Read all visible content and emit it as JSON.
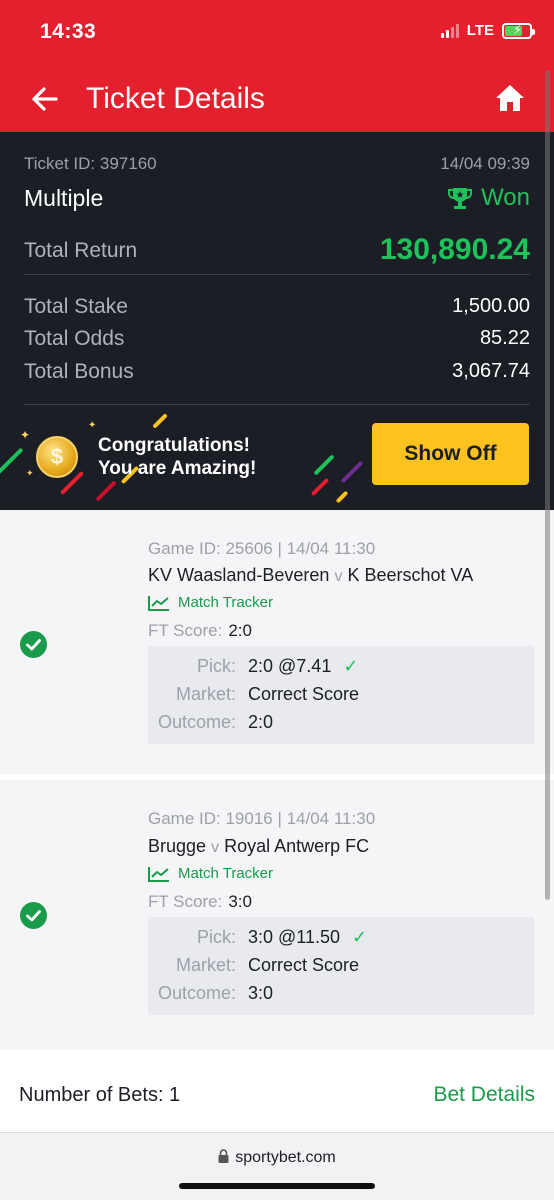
{
  "status_bar": {
    "time": "14:33",
    "network": "LTE"
  },
  "header": {
    "title": "Ticket Details",
    "back_icon": "arrow-left-icon",
    "home_icon": "home-icon"
  },
  "ticket": {
    "id_text": "Ticket ID: 397160",
    "date": "14/04 09:39",
    "type": "Multiple",
    "status": "Won",
    "total_return_label": "Total Return",
    "total_return": "130,890.24",
    "rows": [
      {
        "label": "Total Stake",
        "value": "1,500.00"
      },
      {
        "label": "Total Odds",
        "value": "85.22"
      },
      {
        "label": "Total Bonus",
        "value": "3,067.74"
      }
    ]
  },
  "banner": {
    "line1": "Congratulations!",
    "line2": "You are Amazing!",
    "button": "Show Off",
    "coin_symbol": "$"
  },
  "games": [
    {
      "meta": "Game ID: 25606 | 14/04 11:30",
      "home": "KV Waasland-Beveren",
      "vs": "v",
      "away": "K Beerschot VA",
      "tracker": "Match Tracker",
      "ft_label": "FT Score:",
      "ft_value": "2:0",
      "pick_label": "Pick:",
      "pick_value": "2:0 @7.41",
      "market_label": "Market:",
      "market_value": "Correct Score",
      "outcome_label": "Outcome:",
      "outcome_value": "2:0"
    },
    {
      "meta": "Game ID: 19016 | 14/04 11:30",
      "home": "Brugge",
      "vs": "v",
      "away": "Royal Antwerp FC",
      "tracker": "Match Tracker",
      "ft_label": "FT Score:",
      "ft_value": "3:0",
      "pick_label": "Pick:",
      "pick_value": "3:0 @11.50",
      "market_label": "Market:",
      "market_value": "Correct Score",
      "outcome_label": "Outcome:",
      "outcome_value": "3:0"
    }
  ],
  "footer": {
    "num_bets": "Number of Bets: 1",
    "bet_details": "Bet Details"
  },
  "browser": {
    "url": "sportybet.com"
  },
  "colors": {
    "brand_red": "#e4202e",
    "dark_bg": "#1b1e25",
    "win_green": "#1fc15b",
    "button_yellow": "#fcc21d"
  }
}
